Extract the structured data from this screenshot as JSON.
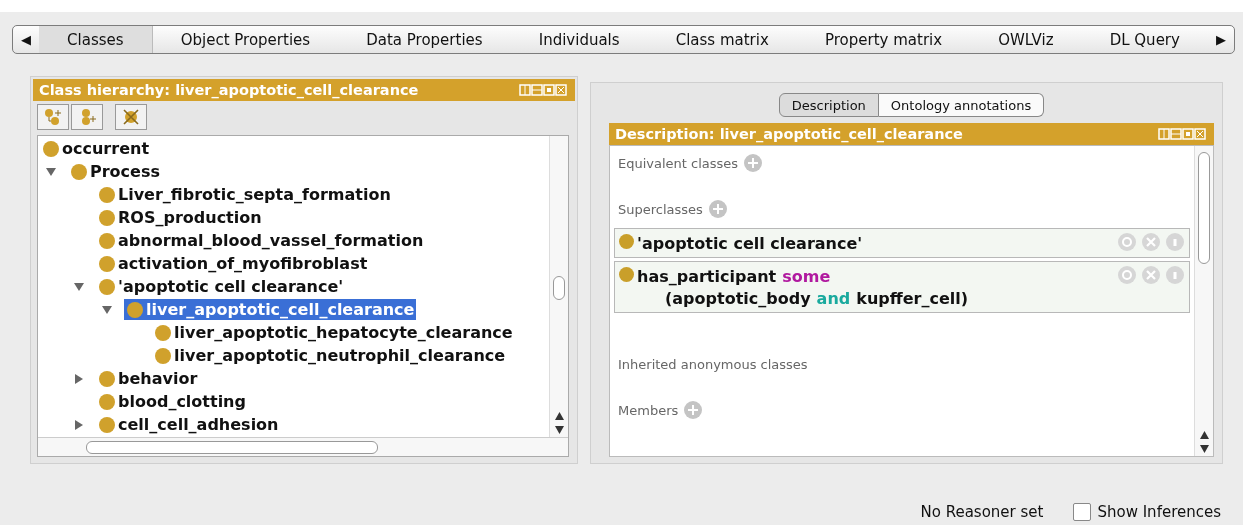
{
  "tab_bar": {
    "scroll_left": "◀",
    "scroll_right": "▶",
    "tabs": [
      {
        "label": "Classes",
        "selected": true
      },
      {
        "label": "Object Properties",
        "selected": false
      },
      {
        "label": "Data Properties",
        "selected": false
      },
      {
        "label": "Individuals",
        "selected": false
      },
      {
        "label": "Class matrix",
        "selected": false
      },
      {
        "label": "Property matrix",
        "selected": false
      },
      {
        "label": "OWLViz",
        "selected": false
      },
      {
        "label": "DL Query",
        "selected": false
      }
    ]
  },
  "class_hierarchy": {
    "title": "Class hierarchy: liver_apoptotic_cell_clearance",
    "tree": [
      {
        "label": "occurrent",
        "selected": false,
        "children": [
          {
            "label": "Process",
            "selected": false,
            "expanded": true,
            "children": [
              {
                "label": "Liver_fibrotic_septa_formation",
                "selected": false
              },
              {
                "label": "ROS_production",
                "selected": false
              },
              {
                "label": "abnormal_blood_vassel_formation",
                "selected": false
              },
              {
                "label": "activation_of_myofibroblast",
                "selected": false
              },
              {
                "label": "'apoptotic cell clearance'",
                "selected": false,
                "expanded": true,
                "children": [
                  {
                    "label": "liver_apoptotic_cell_clearance",
                    "selected": true,
                    "expanded": true,
                    "children": [
                      {
                        "label": "liver_apoptotic_hepatocyte_clearance",
                        "selected": false
                      },
                      {
                        "label": "liver_apoptotic_neutrophil_clearance",
                        "selected": false
                      }
                    ]
                  }
                ]
              },
              {
                "label": "behavior",
                "selected": false,
                "expanded": false
              },
              {
                "label": "blood_clotting",
                "selected": false
              },
              {
                "label": "cell_cell_adhesion",
                "selected": false,
                "expanded": false
              }
            ]
          }
        ]
      }
    ]
  },
  "description": {
    "tabs": [
      {
        "label": "Description",
        "selected": true
      },
      {
        "label": "Ontology annotations",
        "selected": false
      }
    ],
    "title": "Description: liver_apoptotic_cell_clearance",
    "sections": [
      {
        "label": "Equivalent classes",
        "addable": true
      },
      {
        "label": "Superclasses",
        "addable": true,
        "entries": [
          {
            "lines": [
              [
                {
                  "text": "'apoptotic cell clearance'"
                }
              ]
            ]
          },
          {
            "lines": [
              [
                {
                  "text": "has_participant"
                },
                {
                  "text": "some",
                  "color": "#b0199f"
                }
              ],
              [
                {
                  "text": "(apoptotic_body"
                },
                {
                  "text": "and",
                  "color": "#1aaa9e"
                },
                {
                  "text": "kupffer_cell)"
                }
              ]
            ]
          }
        ]
      },
      {
        "label": "Inherited anonymous classes",
        "addable": false
      },
      {
        "label": "Members",
        "addable": true
      }
    ]
  },
  "status_bar": {
    "reasoner": "No Reasoner set",
    "show_inferences": {
      "label": "Show Inferences",
      "checked": false
    }
  }
}
